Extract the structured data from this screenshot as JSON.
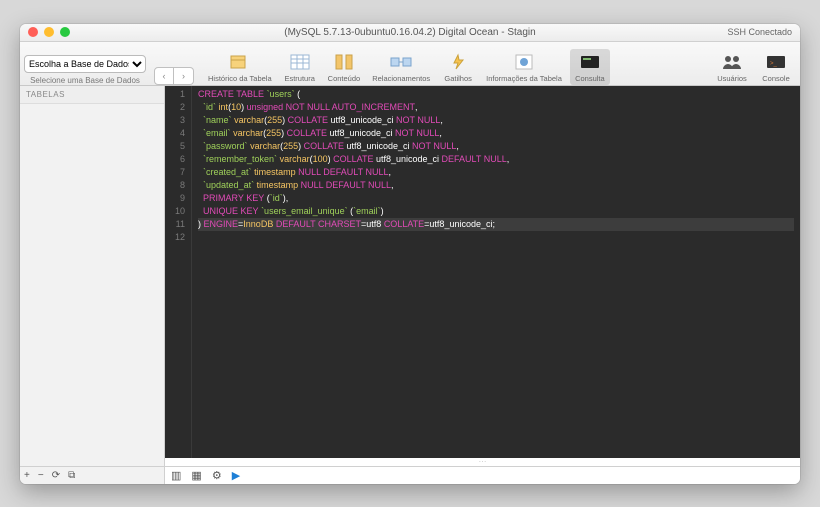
{
  "window": {
    "title": "(MySQL 5.7.13-0ubuntu0.16.04.2) Digital Ocean - Stagin",
    "ssh_status": "SSH Conectado"
  },
  "db_selector": {
    "placeholder": "Escolha a Base de Dados...",
    "subtitle": "Selecione uma Base de Dados"
  },
  "toolbar": {
    "items": [
      {
        "name": "historico",
        "label": "Histórico da Tabela"
      },
      {
        "name": "estrutura",
        "label": "Estrutura"
      },
      {
        "name": "conteudo",
        "label": "Conteúdo"
      },
      {
        "name": "relacionamentos",
        "label": "Relacionamentos"
      },
      {
        "name": "gatilhos",
        "label": "Gatilhos"
      },
      {
        "name": "info",
        "label": "Informações da Tabela"
      },
      {
        "name": "consulta",
        "label": "Consulta",
        "selected": true
      }
    ],
    "right": [
      {
        "name": "usuarios",
        "label": "Usuários"
      },
      {
        "name": "console",
        "label": "Console"
      }
    ]
  },
  "sidebar": {
    "header": "TABELAS"
  },
  "sql": {
    "lines": [
      {
        "pre": "",
        "tokens": [
          [
            "kw",
            "CREATE TABLE"
          ],
          [
            "plain",
            " "
          ],
          [
            "id",
            "`users`"
          ],
          [
            "plain",
            " ("
          ]
        ]
      },
      {
        "pre": "  ",
        "tokens": [
          [
            "id",
            "`id`"
          ],
          [
            "plain",
            " "
          ],
          [
            "fn",
            "int"
          ],
          [
            "plain",
            "("
          ],
          [
            "lit",
            "10"
          ],
          [
            "plain",
            ") "
          ],
          [
            "kw",
            "unsigned NOT NULL AUTO_INCREMENT"
          ],
          [
            "punct",
            ","
          ]
        ]
      },
      {
        "pre": "  ",
        "tokens": [
          [
            "id",
            "`name`"
          ],
          [
            "plain",
            " "
          ],
          [
            "fn",
            "varchar"
          ],
          [
            "plain",
            "("
          ],
          [
            "lit",
            "255"
          ],
          [
            "plain",
            ") "
          ],
          [
            "kw",
            "COLLATE"
          ],
          [
            "plain",
            " utf8_unicode_ci "
          ],
          [
            "kw",
            "NOT NULL"
          ],
          [
            "punct",
            ","
          ]
        ]
      },
      {
        "pre": "  ",
        "tokens": [
          [
            "id",
            "`email`"
          ],
          [
            "plain",
            " "
          ],
          [
            "fn",
            "varchar"
          ],
          [
            "plain",
            "("
          ],
          [
            "lit",
            "255"
          ],
          [
            "plain",
            ") "
          ],
          [
            "kw",
            "COLLATE"
          ],
          [
            "plain",
            " utf8_unicode_ci "
          ],
          [
            "kw",
            "NOT NULL"
          ],
          [
            "punct",
            ","
          ]
        ]
      },
      {
        "pre": "  ",
        "tokens": [
          [
            "id",
            "`password`"
          ],
          [
            "plain",
            " "
          ],
          [
            "fn",
            "varchar"
          ],
          [
            "plain",
            "("
          ],
          [
            "lit",
            "255"
          ],
          [
            "plain",
            ") "
          ],
          [
            "kw",
            "COLLATE"
          ],
          [
            "plain",
            " utf8_unicode_ci "
          ],
          [
            "kw",
            "NOT NULL"
          ],
          [
            "punct",
            ","
          ]
        ]
      },
      {
        "pre": "  ",
        "tokens": [
          [
            "id",
            "`remember_token`"
          ],
          [
            "plain",
            " "
          ],
          [
            "fn",
            "varchar"
          ],
          [
            "plain",
            "("
          ],
          [
            "lit",
            "100"
          ],
          [
            "plain",
            ") "
          ],
          [
            "kw",
            "COLLATE"
          ],
          [
            "plain",
            " utf8_unicode_ci "
          ],
          [
            "kw",
            "DEFAULT NULL"
          ],
          [
            "punct",
            ","
          ]
        ]
      },
      {
        "pre": "  ",
        "tokens": [
          [
            "id",
            "`created_at`"
          ],
          [
            "plain",
            " "
          ],
          [
            "fn",
            "timestamp"
          ],
          [
            "plain",
            " "
          ],
          [
            "kw",
            "NULL DEFAULT NULL"
          ],
          [
            "punct",
            ","
          ]
        ]
      },
      {
        "pre": "  ",
        "tokens": [
          [
            "id",
            "`updated_at`"
          ],
          [
            "plain",
            " "
          ],
          [
            "fn",
            "timestamp"
          ],
          [
            "plain",
            " "
          ],
          [
            "kw",
            "NULL DEFAULT NULL"
          ],
          [
            "punct",
            ","
          ]
        ]
      },
      {
        "pre": "  ",
        "tokens": [
          [
            "kw",
            "PRIMARY KEY"
          ],
          [
            "plain",
            " ("
          ],
          [
            "id",
            "`id`"
          ],
          [
            "plain",
            "),"
          ]
        ]
      },
      {
        "pre": "  ",
        "tokens": [
          [
            "kw",
            "UNIQUE KEY"
          ],
          [
            "plain",
            " "
          ],
          [
            "id",
            "`users_email_unique`"
          ],
          [
            "plain",
            " ("
          ],
          [
            "id",
            "`email`"
          ],
          [
            "plain",
            ")"
          ]
        ]
      },
      {
        "pre": "",
        "hl": true,
        "tokens": [
          [
            "plain",
            ") "
          ],
          [
            "kw",
            "ENGINE"
          ],
          [
            "plain",
            "="
          ],
          [
            "fn",
            "InnoDB"
          ],
          [
            "plain",
            " "
          ],
          [
            "kw",
            "DEFAULT CHARSET"
          ],
          [
            "plain",
            "=utf8 "
          ],
          [
            "kw",
            "COLLATE"
          ],
          [
            "plain",
            "=utf8_unicode_ci;"
          ]
        ]
      },
      {
        "pre": "",
        "tokens": []
      }
    ]
  }
}
